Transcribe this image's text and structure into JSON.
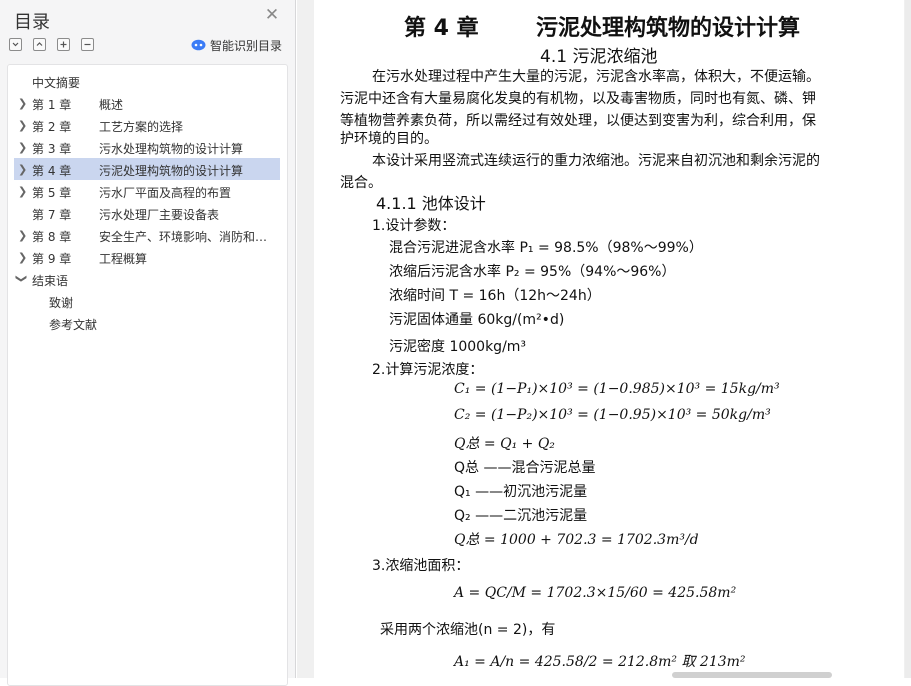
{
  "sidebar": {
    "title": "目录",
    "close_icon": "close-icon",
    "tool_icons": [
      "collapse-all-icon",
      "expand-all-icon",
      "add-heading-icon",
      "remove-heading-icon"
    ],
    "smart_toc_label": "智能识别目录",
    "items": [
      {
        "chapter": "",
        "title": "中文摘要",
        "level": 1,
        "expand": "none",
        "active": false
      },
      {
        "chapter": "第 1 章",
        "title": "概述",
        "level": 1,
        "expand": "collapsed",
        "active": false
      },
      {
        "chapter": "第 2 章",
        "title": "工艺方案的选择",
        "level": 1,
        "expand": "collapsed",
        "active": false
      },
      {
        "chapter": "第 3 章",
        "title": "污水处理构筑物的设计计算",
        "level": 1,
        "expand": "collapsed",
        "active": false
      },
      {
        "chapter": "第 4 章",
        "title": "污泥处理构筑物的设计计算",
        "level": 1,
        "expand": "collapsed",
        "active": true
      },
      {
        "chapter": "第 5 章",
        "title": "污水厂平面及高程的布置",
        "level": 1,
        "expand": "collapsed",
        "active": false
      },
      {
        "chapter": "第 7 章",
        "title": "污水处理厂主要设备表",
        "level": 1,
        "expand": "none",
        "active": false
      },
      {
        "chapter": "第 8 章",
        "title": "安全生产、环境影响、消防和…",
        "level": 1,
        "expand": "collapsed",
        "active": false
      },
      {
        "chapter": "第 9 章",
        "title": "工程概算",
        "level": 1,
        "expand": "collapsed",
        "active": false
      },
      {
        "chapter": "",
        "title": "结束语",
        "level": 1,
        "expand": "expanded",
        "active": false
      },
      {
        "chapter": "",
        "title": "致谢",
        "level": 2,
        "expand": "none",
        "active": false
      },
      {
        "chapter": "",
        "title": "参考文献",
        "level": 2,
        "expand": "none",
        "active": false
      }
    ]
  },
  "document": {
    "chapter_num": "第 4 章",
    "chapter_title": "污泥处理构筑物的设计计算",
    "section_title": "4.1  污泥浓缩池",
    "para1": [
      "在污水处理过程中产生大量的污泥，污泥含水率高，体积大，不便运输。",
      "污泥中还含有大量易腐化发臭的有机物，以及毒害物质，同时也有氮、磷、钾",
      "等植物营养素负荷，所以需经过有效处理，以便达到变害为利，综合利用，保",
      "护环境的目的。"
    ],
    "para2": [
      "本设计采用竖流式连续运行的重力浓缩池。污泥来自初沉池和剩余污泥的",
      "混合。"
    ],
    "subsection_title": "4.1.1  池体设计",
    "step1": "1.设计参数：",
    "params": [
      "混合污泥进泥含水率 P₁ = 98.5%（98%～99%）",
      "浓缩后污泥含水率 P₂ = 95%（94%～96%）",
      "浓缩时间 T = 16h（12h～24h）",
      "污泥固体通量 60kg/(m²•d)",
      "污泥密度 1000kg/m³"
    ],
    "step2": "2.计算污泥浓度：",
    "calc": [
      "C₁ = (1−P₁)×10³ = (1−0.985)×10³ = 15kg/m³",
      "C₂ = (1−P₂)×10³ = (1−0.95)×10³ = 50kg/m³",
      "Q总 = Q₁ + Q₂",
      "Q总 ——混合污泥总量",
      "Q₁ ——初沉池污泥量",
      "Q₂ ——二沉池污泥量",
      "Q总 = 1000 + 702.3 = 1702.3m³/d"
    ],
    "step3": "3.浓缩池面积：",
    "area_formula": "A = QC/M = 1702.3×15/60 = 425.58m²",
    "two_tanks": "采用两个浓缩池(n = 2)，有",
    "a1_formula": "A₁ = A/n = 425.58/2 = 212.8m² 取 213m²"
  }
}
